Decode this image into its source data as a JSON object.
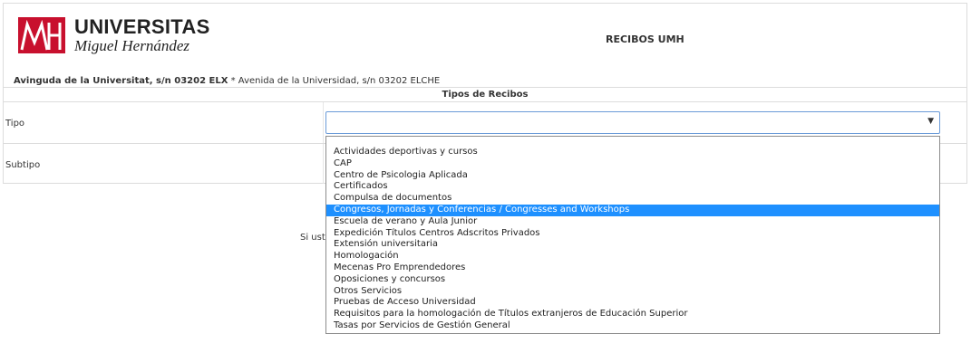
{
  "header": {
    "logo_title": "UNIVERSITAS",
    "logo_subtitle": "Miguel Hernández",
    "page_title": "RECIBOS UMH",
    "address_bold": "Avinguda de la Universitat, s/n 03202 ELX",
    "address_rest": " * Avenida de la Universidad, s/n 03202 ELCHE"
  },
  "form": {
    "section_title": "Tipos de Recibos",
    "tipo_label": "Tipo",
    "subtipo_label": "Subtipo",
    "tipo_value": "",
    "arrow": "▼"
  },
  "background_text": "Si ust",
  "dropdown": {
    "selected_index": 5,
    "options": [
      "Actividades deportivas y cursos",
      "CAP",
      "Centro de Psicologia Aplicada",
      "Certificados",
      "Compulsa de documentos",
      "Congresos, Jornadas y Conferencias / Congresses and Workshops",
      "Escuela de verano y Aula Junior",
      "Expedición Títulos Centros Adscritos Privados",
      "Extensión universitaria",
      "Homologación",
      "Mecenas Pro Emprendedores",
      "Oposiciones y concursos",
      "Otros Servicios",
      "Pruebas de Acceso Universidad",
      "Requisitos para la homologación de Títulos extranjeros de Educación Superior",
      "Tasas por Servicios de Gestión General"
    ]
  },
  "colors": {
    "brand_red": "#c8102e",
    "selected_bg": "#1e90ff",
    "focus_border": "#6b9bd8"
  }
}
